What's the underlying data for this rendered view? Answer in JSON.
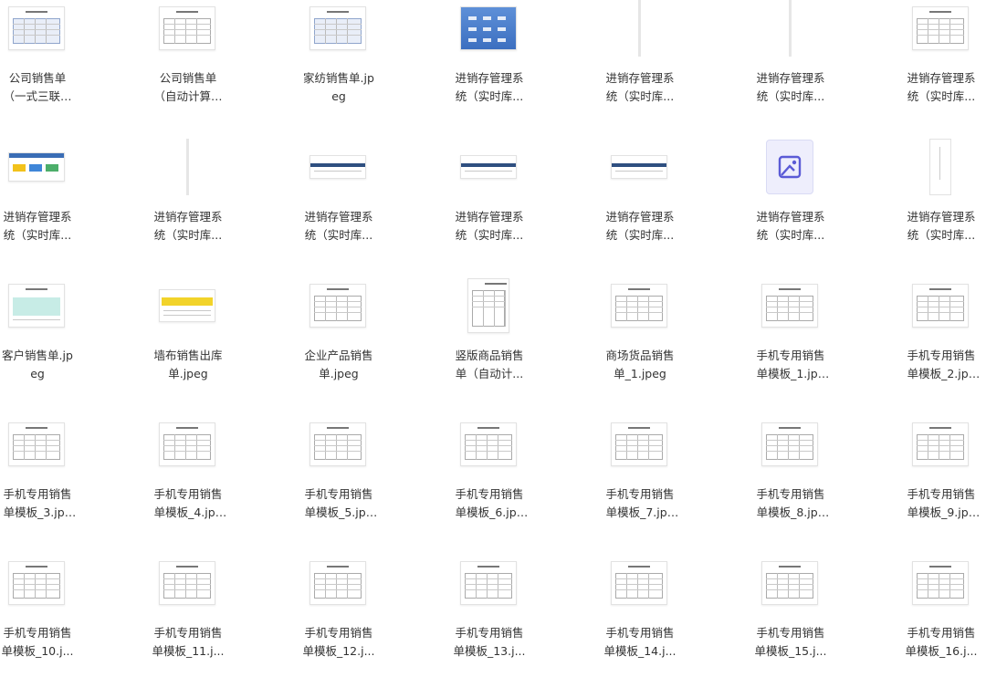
{
  "files": [
    {
      "name": "公司销售单（一式三联）_...",
      "thumb": "sheet-blue"
    },
    {
      "name": "公司销售单（自动计算）_...",
      "thumb": "sheet"
    },
    {
      "name": "家纺销售单.jpeg",
      "thumb": "sheet-blue"
    },
    {
      "name": "进销存管理系统（实时库...",
      "thumb": "app-blue"
    },
    {
      "name": "进销存管理系统（实时库...",
      "thumb": "line"
    },
    {
      "name": "进销存管理系统（实时库...",
      "thumb": "line"
    },
    {
      "name": "进销存管理系统（实时库...",
      "thumb": "sheet"
    },
    {
      "name": "进销存管理系统（实时库...",
      "thumb": "app-bar"
    },
    {
      "name": "进销存管理系统（实时库...",
      "thumb": "line"
    },
    {
      "name": "进销存管理系统（实时库...",
      "thumb": "bar"
    },
    {
      "name": "进销存管理系统（实时库...",
      "thumb": "bar"
    },
    {
      "name": "进销存管理系统（实时库...",
      "thumb": "bar"
    },
    {
      "name": "进销存管理系统（实时库...",
      "thumb": "placeholder"
    },
    {
      "name": "进销存管理系统（实时库...",
      "thumb": "slim"
    },
    {
      "name": "客户销售单.jpeg",
      "thumb": "green"
    },
    {
      "name": "墙布销售出库单.jpeg",
      "thumb": "yellow"
    },
    {
      "name": "企业产品销售单.jpeg",
      "thumb": "sheet"
    },
    {
      "name": "竖版商品销售单（自动计...",
      "thumb": "tall"
    },
    {
      "name": "商场货品销售单_1.jpeg",
      "thumb": "sheet"
    },
    {
      "name": "手机专用销售单模板_1.jpeg",
      "thumb": "sheet"
    },
    {
      "name": "手机专用销售单模板_2.jpeg",
      "thumb": "sheet"
    },
    {
      "name": "手机专用销售单模板_3.jpeg",
      "thumb": "sheet"
    },
    {
      "name": "手机专用销售单模板_4.jpeg",
      "thumb": "sheet"
    },
    {
      "name": "手机专用销售单模板_5.jpeg",
      "thumb": "sheet"
    },
    {
      "name": "手机专用销售单模板_6.jpeg",
      "thumb": "sheet"
    },
    {
      "name": "手机专用销售单模板_7.jpeg",
      "thumb": "sheet"
    },
    {
      "name": "手机专用销售单模板_8.jpeg",
      "thumb": "sheet"
    },
    {
      "name": "手机专用销售单模板_9.jpeg",
      "thumb": "sheet"
    },
    {
      "name": "手机专用销售单模板_10.j...",
      "thumb": "sheet"
    },
    {
      "name": "手机专用销售单模板_11.j...",
      "thumb": "sheet"
    },
    {
      "name": "手机专用销售单模板_12.j...",
      "thumb": "sheet"
    },
    {
      "name": "手机专用销售单模板_13.j...",
      "thumb": "sheet"
    },
    {
      "name": "手机专用销售单模板_14.j...",
      "thumb": "sheet"
    },
    {
      "name": "手机专用销售单模板_15.j...",
      "thumb": "sheet"
    },
    {
      "name": "手机专用销售单模板_16.j...",
      "thumb": "sheet"
    }
  ],
  "colors": {
    "text": "#333333",
    "placeholder_icon": "#5b5bd6"
  }
}
